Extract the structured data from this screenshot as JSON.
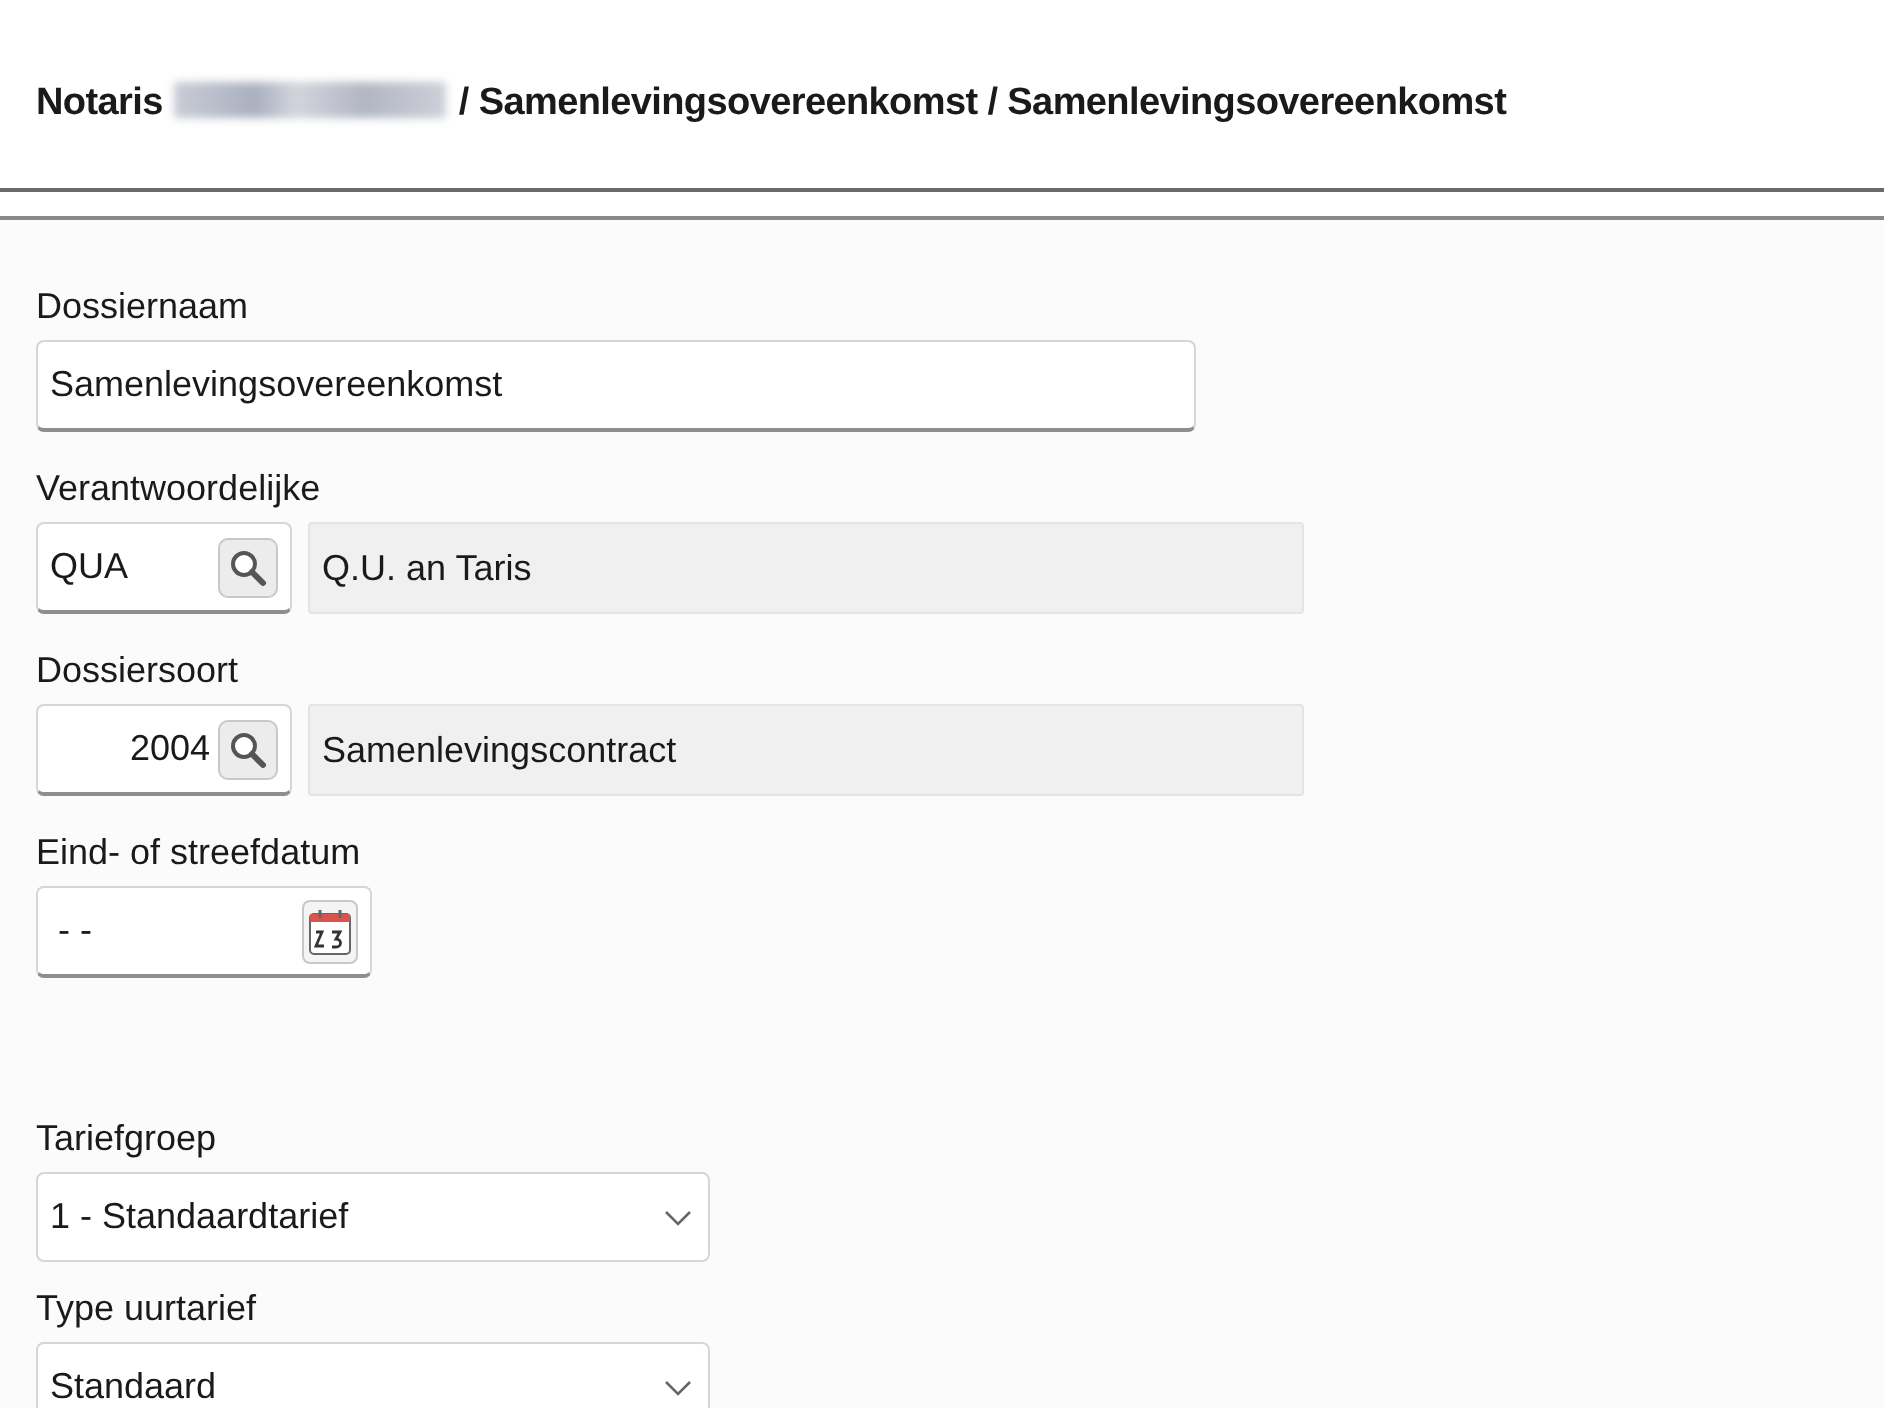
{
  "breadcrumb": {
    "prefix": "Notaris",
    "redacted": true,
    "rest": "/ Samenlevingsovereenkomst / Samenlevingsovereenkomst"
  },
  "fields": [
    {
      "kind": "text",
      "label": "Dossiernaam",
      "value": "Samenlevingsovereenkomst"
    },
    {
      "kind": "lookup",
      "label": "Verantwoordelijke",
      "code": "QUA",
      "description": "Q.U. an Taris"
    },
    {
      "kind": "numeric-lookup",
      "label": "Dossiersoort",
      "code": "2004",
      "description": "Samenlevingscontract"
    },
    {
      "kind": "date",
      "label": "Eind- of streefdatum",
      "value": "- -"
    },
    {
      "kind": "select",
      "label": "Tariefgroep",
      "value": "1 - Standaardtarief"
    },
    {
      "kind": "select",
      "label": "Type uurtarief",
      "value": "Standaard"
    }
  ]
}
